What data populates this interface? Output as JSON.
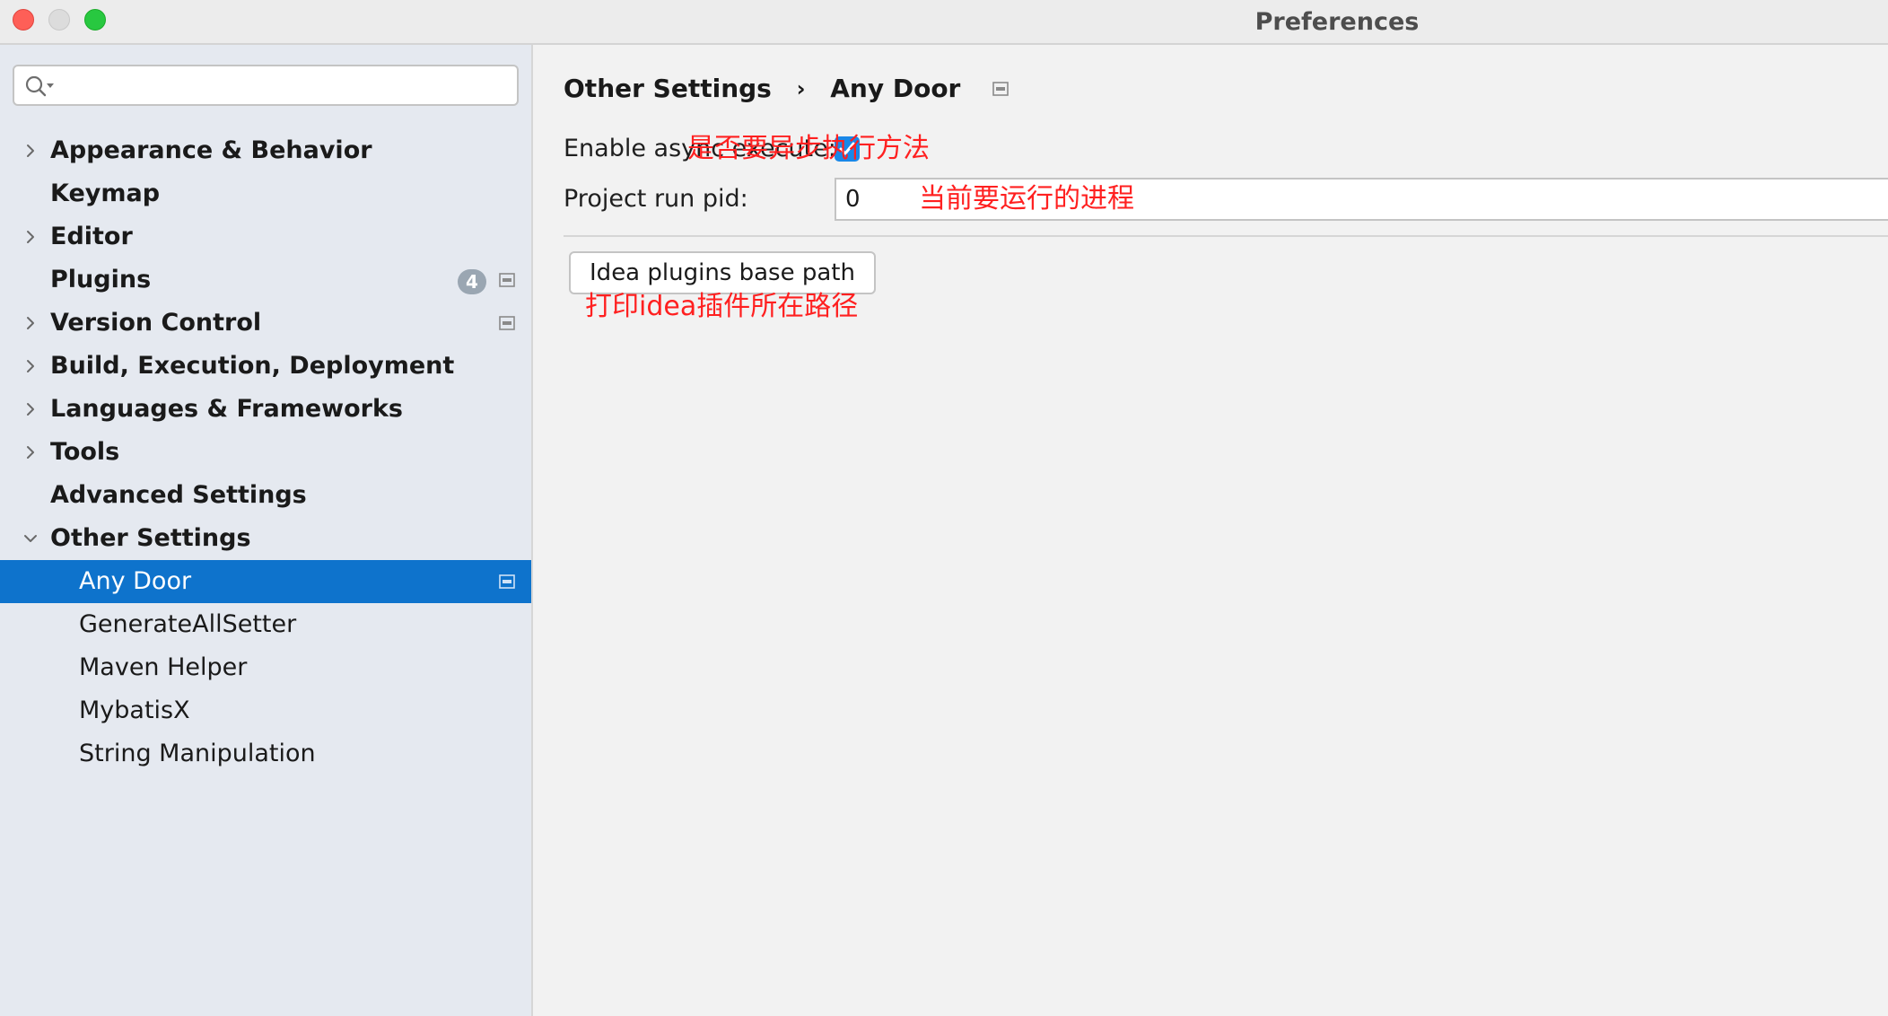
{
  "window": {
    "title": "Preferences"
  },
  "search": {
    "value": "",
    "placeholder": ""
  },
  "sidebar": {
    "items": [
      {
        "label": "Appearance & Behavior",
        "expandable": true,
        "expanded": false,
        "level": 0
      },
      {
        "label": "Keymap",
        "expandable": false,
        "level": 0
      },
      {
        "label": "Editor",
        "expandable": true,
        "expanded": false,
        "level": 0
      },
      {
        "label": "Plugins",
        "expandable": false,
        "level": 0,
        "badge": "4",
        "project_icon": true
      },
      {
        "label": "Version Control",
        "expandable": true,
        "expanded": false,
        "level": 0,
        "project_icon": true
      },
      {
        "label": "Build, Execution, Deployment",
        "expandable": true,
        "expanded": false,
        "level": 0
      },
      {
        "label": "Languages & Frameworks",
        "expandable": true,
        "expanded": false,
        "level": 0
      },
      {
        "label": "Tools",
        "expandable": true,
        "expanded": false,
        "level": 0
      },
      {
        "label": "Advanced Settings",
        "expandable": false,
        "level": 0
      },
      {
        "label": "Other Settings",
        "expandable": true,
        "expanded": true,
        "level": 0
      },
      {
        "label": "Any Door",
        "level": 1,
        "selected": true,
        "project_icon": true
      },
      {
        "label": "GenerateAllSetter",
        "level": 1
      },
      {
        "label": "Maven Helper",
        "level": 1
      },
      {
        "label": "MybatisX",
        "level": 1
      },
      {
        "label": "String Manipulation",
        "level": 1
      }
    ]
  },
  "main": {
    "breadcrumb": {
      "parent": "Other Settings",
      "separator": "›",
      "current": "Any Door"
    },
    "async_execute": {
      "label": "Enable async execute:",
      "checked": true,
      "annotation": "是否要异步执行方法"
    },
    "project_run_pid": {
      "label": "Project run pid:",
      "value": "0",
      "annotation": "当前要运行的进程"
    },
    "plugins_base_path": {
      "button_label": "Idea plugins base path",
      "annotation": "打印idea插件所在路径"
    }
  },
  "colors": {
    "selection": "#0e73cc",
    "checkbox": "#1a88e8",
    "annotation": "#ff2020",
    "sidebar_bg": "#e5e9f0",
    "content_bg": "#f2f2f2"
  },
  "icons": {
    "close": "close-window-icon",
    "minimize": "minimize-window-icon",
    "maximize": "maximize-window-icon",
    "search": "search-icon",
    "chevron_right": "chevron-right-icon",
    "chevron_down": "chevron-down-icon",
    "project_settings": "project-settings-icon",
    "checkmark": "checkmark-icon"
  }
}
